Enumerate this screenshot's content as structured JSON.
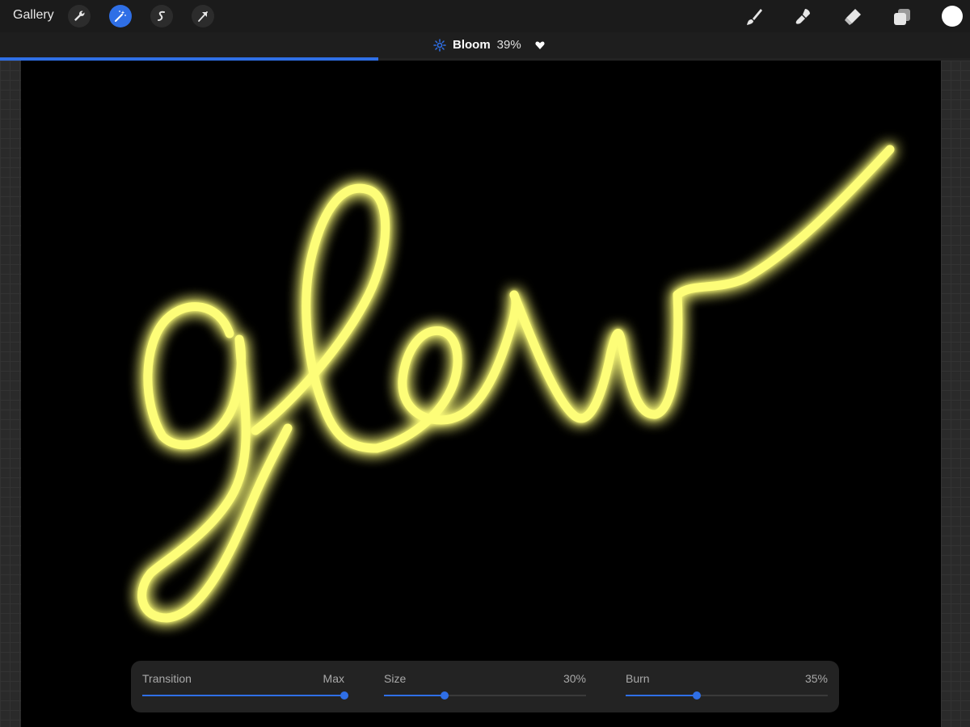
{
  "topbar": {
    "gallery_label": "Gallery",
    "left_tools": [
      "wrench-icon",
      "magic-wand-icon",
      "selection-icon",
      "transform-arrow-icon"
    ],
    "active_tool": "magic-wand-icon",
    "right_tools": [
      "brush-icon",
      "smudge-icon",
      "eraser-icon",
      "layers-icon"
    ],
    "current_color": "#ffffff"
  },
  "adjustment": {
    "icon": "bloom-icon",
    "name": "Bloom",
    "percent": "39%",
    "level": 0.39
  },
  "canvas": {
    "text": "glow",
    "stroke_color": "#fdfd78",
    "background": "#000000"
  },
  "sliders": [
    {
      "label": "Transition",
      "value": "Max",
      "level": 1.0
    },
    {
      "label": "Size",
      "value": "30%",
      "level": 0.3
    },
    {
      "label": "Burn",
      "value": "35%",
      "level": 0.35
    }
  ],
  "colors": {
    "accent": "#2f6fe6",
    "toolbar": "#1b1b1b",
    "panel": "#232323"
  }
}
